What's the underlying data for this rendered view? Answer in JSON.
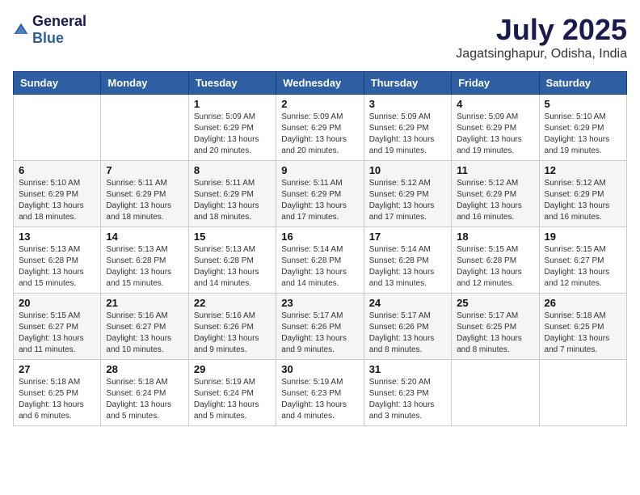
{
  "logo": {
    "general": "General",
    "blue": "Blue"
  },
  "title": {
    "month_year": "July 2025",
    "location": "Jagatsinghapur, Odisha, India"
  },
  "days_of_week": [
    "Sunday",
    "Monday",
    "Tuesday",
    "Wednesday",
    "Thursday",
    "Friday",
    "Saturday"
  ],
  "weeks": [
    [
      {
        "day": "",
        "content": ""
      },
      {
        "day": "",
        "content": ""
      },
      {
        "day": "1",
        "content": "Sunrise: 5:09 AM\nSunset: 6:29 PM\nDaylight: 13 hours and 20 minutes."
      },
      {
        "day": "2",
        "content": "Sunrise: 5:09 AM\nSunset: 6:29 PM\nDaylight: 13 hours and 20 minutes."
      },
      {
        "day": "3",
        "content": "Sunrise: 5:09 AM\nSunset: 6:29 PM\nDaylight: 13 hours and 19 minutes."
      },
      {
        "day": "4",
        "content": "Sunrise: 5:09 AM\nSunset: 6:29 PM\nDaylight: 13 hours and 19 minutes."
      },
      {
        "day": "5",
        "content": "Sunrise: 5:10 AM\nSunset: 6:29 PM\nDaylight: 13 hours and 19 minutes."
      }
    ],
    [
      {
        "day": "6",
        "content": "Sunrise: 5:10 AM\nSunset: 6:29 PM\nDaylight: 13 hours and 18 minutes."
      },
      {
        "day": "7",
        "content": "Sunrise: 5:11 AM\nSunset: 6:29 PM\nDaylight: 13 hours and 18 minutes."
      },
      {
        "day": "8",
        "content": "Sunrise: 5:11 AM\nSunset: 6:29 PM\nDaylight: 13 hours and 18 minutes."
      },
      {
        "day": "9",
        "content": "Sunrise: 5:11 AM\nSunset: 6:29 PM\nDaylight: 13 hours and 17 minutes."
      },
      {
        "day": "10",
        "content": "Sunrise: 5:12 AM\nSunset: 6:29 PM\nDaylight: 13 hours and 17 minutes."
      },
      {
        "day": "11",
        "content": "Sunrise: 5:12 AM\nSunset: 6:29 PM\nDaylight: 13 hours and 16 minutes."
      },
      {
        "day": "12",
        "content": "Sunrise: 5:12 AM\nSunset: 6:29 PM\nDaylight: 13 hours and 16 minutes."
      }
    ],
    [
      {
        "day": "13",
        "content": "Sunrise: 5:13 AM\nSunset: 6:28 PM\nDaylight: 13 hours and 15 minutes."
      },
      {
        "day": "14",
        "content": "Sunrise: 5:13 AM\nSunset: 6:28 PM\nDaylight: 13 hours and 15 minutes."
      },
      {
        "day": "15",
        "content": "Sunrise: 5:13 AM\nSunset: 6:28 PM\nDaylight: 13 hours and 14 minutes."
      },
      {
        "day": "16",
        "content": "Sunrise: 5:14 AM\nSunset: 6:28 PM\nDaylight: 13 hours and 14 minutes."
      },
      {
        "day": "17",
        "content": "Sunrise: 5:14 AM\nSunset: 6:28 PM\nDaylight: 13 hours and 13 minutes."
      },
      {
        "day": "18",
        "content": "Sunrise: 5:15 AM\nSunset: 6:28 PM\nDaylight: 13 hours and 12 minutes."
      },
      {
        "day": "19",
        "content": "Sunrise: 5:15 AM\nSunset: 6:27 PM\nDaylight: 13 hours and 12 minutes."
      }
    ],
    [
      {
        "day": "20",
        "content": "Sunrise: 5:15 AM\nSunset: 6:27 PM\nDaylight: 13 hours and 11 minutes."
      },
      {
        "day": "21",
        "content": "Sunrise: 5:16 AM\nSunset: 6:27 PM\nDaylight: 13 hours and 10 minutes."
      },
      {
        "day": "22",
        "content": "Sunrise: 5:16 AM\nSunset: 6:26 PM\nDaylight: 13 hours and 9 minutes."
      },
      {
        "day": "23",
        "content": "Sunrise: 5:17 AM\nSunset: 6:26 PM\nDaylight: 13 hours and 9 minutes."
      },
      {
        "day": "24",
        "content": "Sunrise: 5:17 AM\nSunset: 6:26 PM\nDaylight: 13 hours and 8 minutes."
      },
      {
        "day": "25",
        "content": "Sunrise: 5:17 AM\nSunset: 6:25 PM\nDaylight: 13 hours and 8 minutes."
      },
      {
        "day": "26",
        "content": "Sunrise: 5:18 AM\nSunset: 6:25 PM\nDaylight: 13 hours and 7 minutes."
      }
    ],
    [
      {
        "day": "27",
        "content": "Sunrise: 5:18 AM\nSunset: 6:25 PM\nDaylight: 13 hours and 6 minutes."
      },
      {
        "day": "28",
        "content": "Sunrise: 5:18 AM\nSunset: 6:24 PM\nDaylight: 13 hours and 5 minutes."
      },
      {
        "day": "29",
        "content": "Sunrise: 5:19 AM\nSunset: 6:24 PM\nDaylight: 13 hours and 5 minutes."
      },
      {
        "day": "30",
        "content": "Sunrise: 5:19 AM\nSunset: 6:23 PM\nDaylight: 13 hours and 4 minutes."
      },
      {
        "day": "31",
        "content": "Sunrise: 5:20 AM\nSunset: 6:23 PM\nDaylight: 13 hours and 3 minutes."
      },
      {
        "day": "",
        "content": ""
      },
      {
        "day": "",
        "content": ""
      }
    ]
  ]
}
